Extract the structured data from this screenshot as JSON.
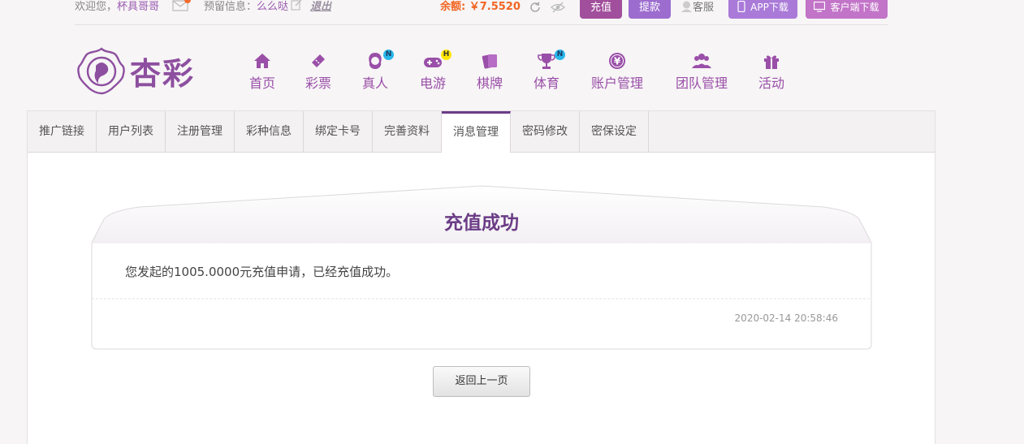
{
  "topbar": {
    "welcome_prefix": "欢迎您，",
    "username": "杯具哥哥",
    "note_label": "预留信息：",
    "note_value": "么么哒",
    "logout": "退出",
    "balance": "余额: ￥7.5520",
    "recharge": "充值",
    "withdraw": "提款",
    "service": "客服",
    "app_download": "APP下载",
    "client_download": "客户端下载"
  },
  "logo": {
    "text": "杏彩"
  },
  "nav": [
    {
      "label": "首页",
      "icon": "home-icon"
    },
    {
      "label": "彩票",
      "icon": "ticket-icon"
    },
    {
      "label": "真人",
      "icon": "live-dealer-icon",
      "badge": "N"
    },
    {
      "label": "电游",
      "icon": "gamepad-icon",
      "badge": "H"
    },
    {
      "label": "棋牌",
      "icon": "cards-icon"
    },
    {
      "label": "体育",
      "icon": "trophy-icon",
      "badge": "N"
    },
    {
      "label": "账户管理",
      "icon": "yen-coin-icon"
    },
    {
      "label": "团队管理",
      "icon": "team-icon"
    },
    {
      "label": "活动",
      "icon": "gift-icon"
    }
  ],
  "tabs": [
    {
      "label": "推广链接"
    },
    {
      "label": "用户列表"
    },
    {
      "label": "注册管理"
    },
    {
      "label": "彩种信息"
    },
    {
      "label": "绑定卡号"
    },
    {
      "label": "完善资料"
    },
    {
      "label": "消息管理",
      "active": true
    },
    {
      "label": "密码修改"
    },
    {
      "label": "密保设定"
    }
  ],
  "message": {
    "title": "充值成功",
    "body": "您发起的1005.0000元充值申请，已经充值成功。",
    "time": "2020-02-14 20:58:46"
  },
  "back_button": "返回上一页",
  "colors": {
    "brand": "#8d4f9f",
    "active_tab": "#6b3c86",
    "balance": "#f26522",
    "recharge": "#a14f9c",
    "withdraw": "#9c6ccf"
  }
}
